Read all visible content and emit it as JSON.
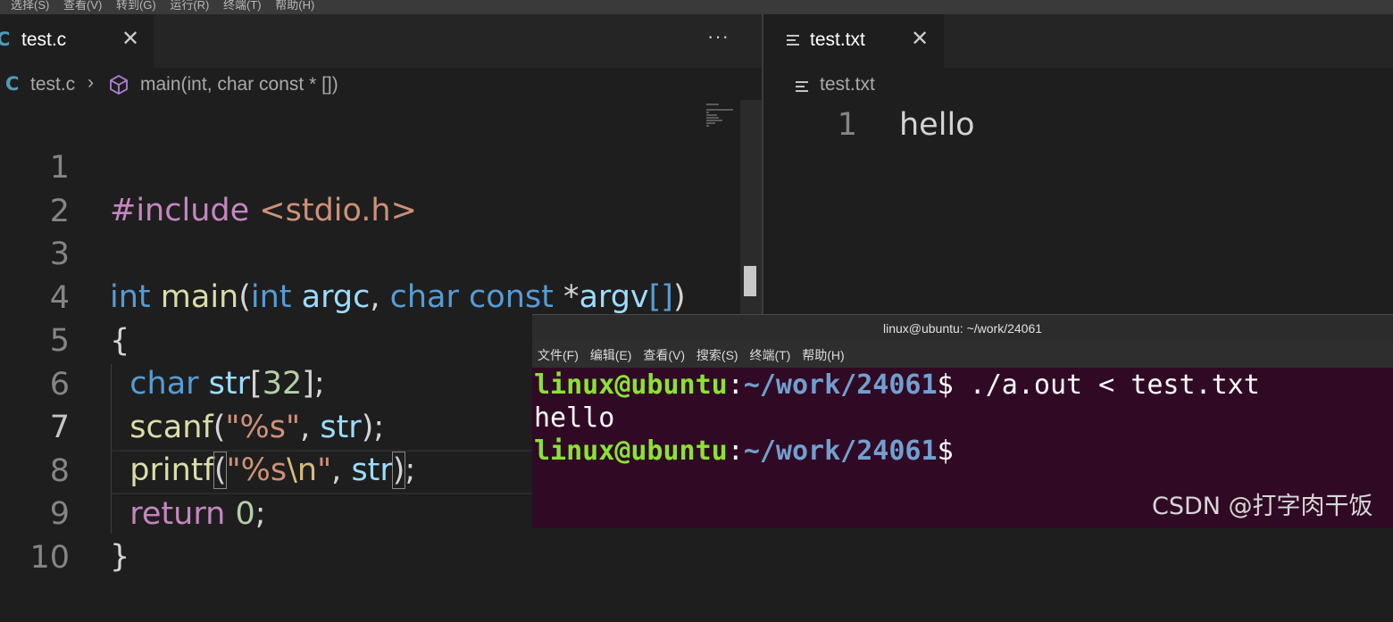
{
  "menubar": {
    "items": [
      "选择(S)",
      "查看(V)",
      "转到(G)",
      "运行(R)",
      "终端(T)",
      "帮助(H)"
    ]
  },
  "left_editor": {
    "tab": {
      "icon": "c-file-icon",
      "icon_text": "C",
      "label": "test.c",
      "close": "✕"
    },
    "more_actions": "···",
    "breadcrumb": {
      "icon_text": "C",
      "file": "test.c",
      "separator": "›",
      "symbol_icon": "method-cube-icon",
      "function": "main(int, char const * [])"
    },
    "line_numbers": [
      "1",
      "2",
      "3",
      "4",
      "5",
      "6",
      "7",
      "8",
      "9",
      "10"
    ],
    "current_line": "7"
  },
  "right_editor": {
    "tab": {
      "icon": "text-file-icon",
      "label": "test.txt",
      "close": "✕"
    },
    "breadcrumb": {
      "file": "test.txt"
    },
    "line_number": "1",
    "content": "hello"
  },
  "terminal": {
    "title": "linux@ubuntu: ~/work/24061",
    "menu": [
      "文件(F)",
      "编辑(E)",
      "查看(V)",
      "搜索(S)",
      "终端(T)",
      "帮助(H)"
    ],
    "prompt_user": "linux@ubuntu",
    "prompt_colon": ":",
    "prompt_path": "~/work/24061",
    "prompt_dollar": "$",
    "command": " ./a.out < test.txt",
    "output": "hello"
  },
  "watermark": "CSDN @打字肉干饭"
}
